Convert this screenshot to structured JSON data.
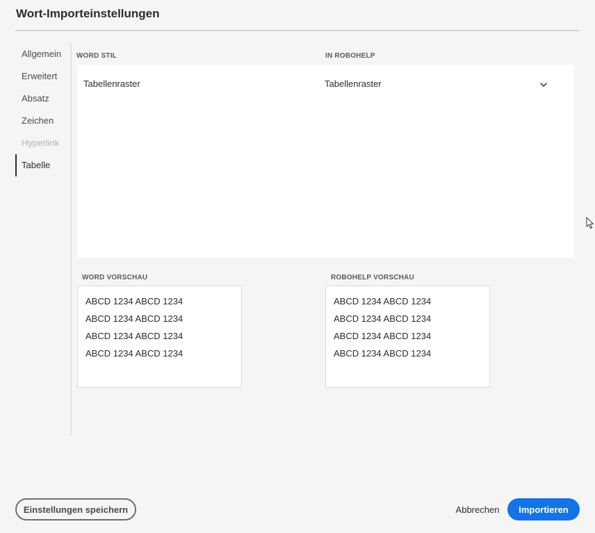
{
  "dialog": {
    "title": "Wort-Importeinstellungen"
  },
  "nav": {
    "items": [
      {
        "label": "Allgemein",
        "state": "normal"
      },
      {
        "label": "Erweitert",
        "state": "normal"
      },
      {
        "label": "Absatz",
        "state": "normal"
      },
      {
        "label": "Zeichen",
        "state": "normal"
      },
      {
        "label": "Hyperlink",
        "state": "disabled"
      },
      {
        "label": "Tabelle",
        "state": "selected"
      }
    ]
  },
  "mapping": {
    "columns": {
      "word": "WORD STIL",
      "robohelp": "IN ROBOHELP"
    },
    "rows": [
      {
        "word_style": "Tabellenraster",
        "robohelp_style": "Tabellenraster",
        "icon": "chevron-down-icon"
      }
    ]
  },
  "preview": {
    "word_label": "WORD VORSCHAU",
    "robohelp_label": "ROBOHELP VORSCHAU",
    "word_lines": [
      "ABCD 1234 ABCD 1234",
      "ABCD 1234 ABCD 1234",
      "ABCD 1234 ABCD 1234",
      "ABCD 1234 ABCD 1234"
    ],
    "robohelp_lines": [
      "ABCD 1234 ABCD 1234",
      "ABCD 1234 ABCD 1234",
      "ABCD 1234 ABCD 1234",
      "ABCD 1234 ABCD 1234"
    ]
  },
  "footer": {
    "save_label": "Einstellungen speichern",
    "cancel_label": "Abbrechen",
    "import_label": "Importieren"
  },
  "colors": {
    "accent": "#1473e6",
    "background": "#f5f5f5",
    "panel": "#ffffff"
  }
}
